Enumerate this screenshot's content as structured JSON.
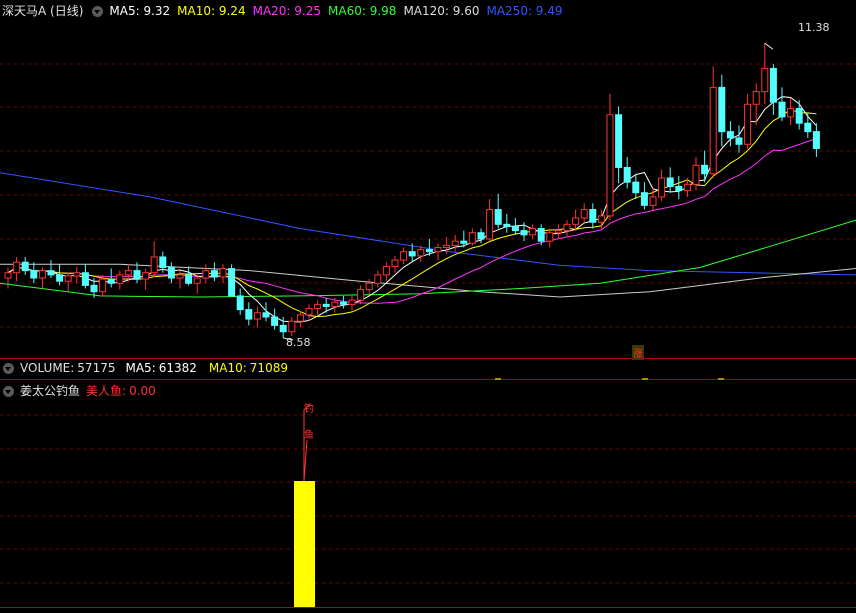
{
  "price_legend": {
    "title": "深天马A (日线)",
    "ma": [
      {
        "label": "MA5:",
        "value": "9.32",
        "color": "#ffffff"
      },
      {
        "label": "MA10:",
        "value": "9.24",
        "color": "#ffff00"
      },
      {
        "label": "MA20:",
        "value": "9.25",
        "color": "#ff33ff"
      },
      {
        "label": "MA60:",
        "value": "9.98",
        "color": "#33ff33"
      },
      {
        "label": "MA120:",
        "value": "9.60",
        "color": "#dddddd"
      },
      {
        "label": "MA250:",
        "value": "9.49",
        "color": "#3355ff"
      }
    ]
  },
  "annotations": {
    "high": "11.38",
    "low": "8.58",
    "marker": "涨"
  },
  "volume_legend": {
    "label": "VOLUME:",
    "value": "57175",
    "ma5_label": "MA5:",
    "ma5_value": "61382",
    "ma10_label": "MA10:",
    "ma10_value": "71089"
  },
  "indicator_legend": {
    "name": "姜太公钓鱼",
    "sub_label": "美人鱼:",
    "sub_value": "0.00",
    "signal_text": [
      "钓",
      "鱼"
    ],
    "signal_value": 1
  },
  "colors": {
    "up": "#ff3232",
    "down": "#54ffff",
    "grid": "#7a0000",
    "signal": "#ffff00"
  },
  "chart_data": {
    "type": "candlestick",
    "y_range": [
      8.4,
      11.6
    ],
    "candles": [
      [
        9.15,
        9.25,
        9.05,
        9.2
      ],
      [
        9.2,
        9.35,
        9.12,
        9.3
      ],
      [
        9.3,
        9.35,
        9.18,
        9.22
      ],
      [
        9.22,
        9.3,
        9.1,
        9.15
      ],
      [
        9.15,
        9.25,
        9.05,
        9.22
      ],
      [
        9.22,
        9.32,
        9.15,
        9.18
      ],
      [
        9.18,
        9.28,
        9.08,
        9.12
      ],
      [
        9.12,
        9.2,
        9.02,
        9.17
      ],
      [
        9.17,
        9.26,
        9.1,
        9.2
      ],
      [
        9.2,
        9.28,
        9.05,
        9.08
      ],
      [
        9.08,
        9.15,
        8.96,
        9.02
      ],
      [
        9.02,
        9.18,
        8.98,
        9.14
      ],
      [
        9.14,
        9.24,
        9.06,
        9.1
      ],
      [
        9.1,
        9.22,
        9.04,
        9.18
      ],
      [
        9.18,
        9.28,
        9.12,
        9.22
      ],
      [
        9.22,
        9.3,
        9.1,
        9.14
      ],
      [
        9.14,
        9.24,
        9.04,
        9.2
      ],
      [
        9.2,
        9.5,
        9.16,
        9.35
      ],
      [
        9.35,
        9.4,
        9.2,
        9.25
      ],
      [
        9.25,
        9.3,
        9.1,
        9.15
      ],
      [
        9.15,
        9.22,
        9.05,
        9.18
      ],
      [
        9.18,
        9.26,
        9.08,
        9.1
      ],
      [
        9.1,
        9.18,
        9.0,
        9.15
      ],
      [
        9.15,
        9.28,
        9.1,
        9.22
      ],
      [
        9.22,
        9.3,
        9.12,
        9.16
      ],
      [
        9.16,
        9.28,
        9.1,
        9.24
      ],
      [
        9.24,
        9.28,
        9.0,
        8.98
      ],
      [
        8.98,
        9.05,
        8.8,
        8.85
      ],
      [
        8.85,
        8.92,
        8.7,
        8.76
      ],
      [
        8.76,
        8.88,
        8.68,
        8.82
      ],
      [
        8.82,
        8.92,
        8.74,
        8.78
      ],
      [
        8.78,
        8.86,
        8.66,
        8.7
      ],
      [
        8.7,
        8.78,
        8.58,
        8.64
      ],
      [
        8.64,
        8.78,
        8.6,
        8.74
      ],
      [
        8.74,
        8.84,
        8.68,
        8.8
      ],
      [
        8.8,
        8.9,
        8.74,
        8.86
      ],
      [
        8.86,
        8.94,
        8.8,
        8.9
      ],
      [
        8.9,
        8.96,
        8.82,
        8.88
      ],
      [
        8.88,
        8.96,
        8.82,
        8.92
      ],
      [
        8.92,
        8.98,
        8.86,
        8.9
      ],
      [
        8.9,
        8.98,
        8.84,
        8.94
      ],
      [
        8.94,
        9.08,
        8.9,
        9.04
      ],
      [
        9.04,
        9.14,
        9.0,
        9.1
      ],
      [
        9.1,
        9.22,
        9.06,
        9.18
      ],
      [
        9.18,
        9.3,
        9.12,
        9.26
      ],
      [
        9.26,
        9.36,
        9.2,
        9.32
      ],
      [
        9.32,
        9.44,
        9.28,
        9.4
      ],
      [
        9.4,
        9.48,
        9.3,
        9.36
      ],
      [
        9.36,
        9.46,
        9.3,
        9.42
      ],
      [
        9.42,
        9.52,
        9.36,
        9.4
      ],
      [
        9.4,
        9.48,
        9.32,
        9.44
      ],
      [
        9.44,
        9.54,
        9.38,
        9.46
      ],
      [
        9.46,
        9.56,
        9.4,
        9.5
      ],
      [
        9.5,
        9.6,
        9.44,
        9.48
      ],
      [
        9.48,
        9.62,
        9.46,
        9.58
      ],
      [
        9.58,
        9.62,
        9.48,
        9.52
      ],
      [
        9.52,
        9.9,
        9.5,
        9.8
      ],
      [
        9.8,
        9.95,
        9.62,
        9.66
      ],
      [
        9.66,
        9.76,
        9.58,
        9.64
      ],
      [
        9.64,
        9.72,
        9.56,
        9.6
      ],
      [
        9.6,
        9.68,
        9.5,
        9.56
      ],
      [
        9.56,
        9.66,
        9.52,
        9.62
      ],
      [
        9.62,
        9.66,
        9.46,
        9.5
      ],
      [
        9.5,
        9.62,
        9.44,
        9.58
      ],
      [
        9.58,
        9.66,
        9.52,
        9.6
      ],
      [
        9.6,
        9.7,
        9.54,
        9.66
      ],
      [
        9.66,
        9.8,
        9.6,
        9.72
      ],
      [
        9.72,
        9.86,
        9.66,
        9.8
      ],
      [
        9.8,
        9.86,
        9.62,
        9.68
      ],
      [
        9.68,
        9.8,
        9.6,
        9.74
      ],
      [
        9.74,
        10.9,
        9.7,
        10.7
      ],
      [
        10.7,
        10.78,
        10.05,
        10.2
      ],
      [
        10.2,
        10.3,
        10.0,
        10.06
      ],
      [
        10.06,
        10.14,
        9.9,
        9.96
      ],
      [
        9.96,
        10.06,
        9.8,
        9.84
      ],
      [
        9.84,
        10.0,
        9.78,
        9.92
      ],
      [
        9.92,
        10.18,
        9.88,
        10.1
      ],
      [
        10.1,
        10.2,
        9.96,
        10.02
      ],
      [
        10.02,
        10.12,
        9.9,
        9.98
      ],
      [
        9.98,
        10.1,
        9.92,
        10.04
      ],
      [
        10.04,
        10.3,
        9.98,
        10.22
      ],
      [
        10.22,
        10.36,
        10.06,
        10.14
      ],
      [
        10.14,
        11.16,
        10.1,
        10.96
      ],
      [
        10.96,
        11.08,
        10.4,
        10.54
      ],
      [
        10.54,
        10.64,
        10.4,
        10.48
      ],
      [
        10.48,
        10.6,
        10.34,
        10.42
      ],
      [
        10.42,
        10.9,
        10.38,
        10.8
      ],
      [
        10.8,
        11.0,
        10.6,
        10.92
      ],
      [
        10.92,
        11.38,
        10.8,
        11.14
      ],
      [
        11.14,
        11.18,
        10.7,
        10.82
      ],
      [
        10.82,
        10.96,
        10.64,
        10.68
      ],
      [
        10.68,
        10.86,
        10.6,
        10.76
      ],
      [
        10.76,
        10.84,
        10.56,
        10.62
      ],
      [
        10.62,
        10.72,
        10.48,
        10.54
      ],
      [
        10.54,
        10.62,
        10.3,
        10.38
      ]
    ]
  }
}
